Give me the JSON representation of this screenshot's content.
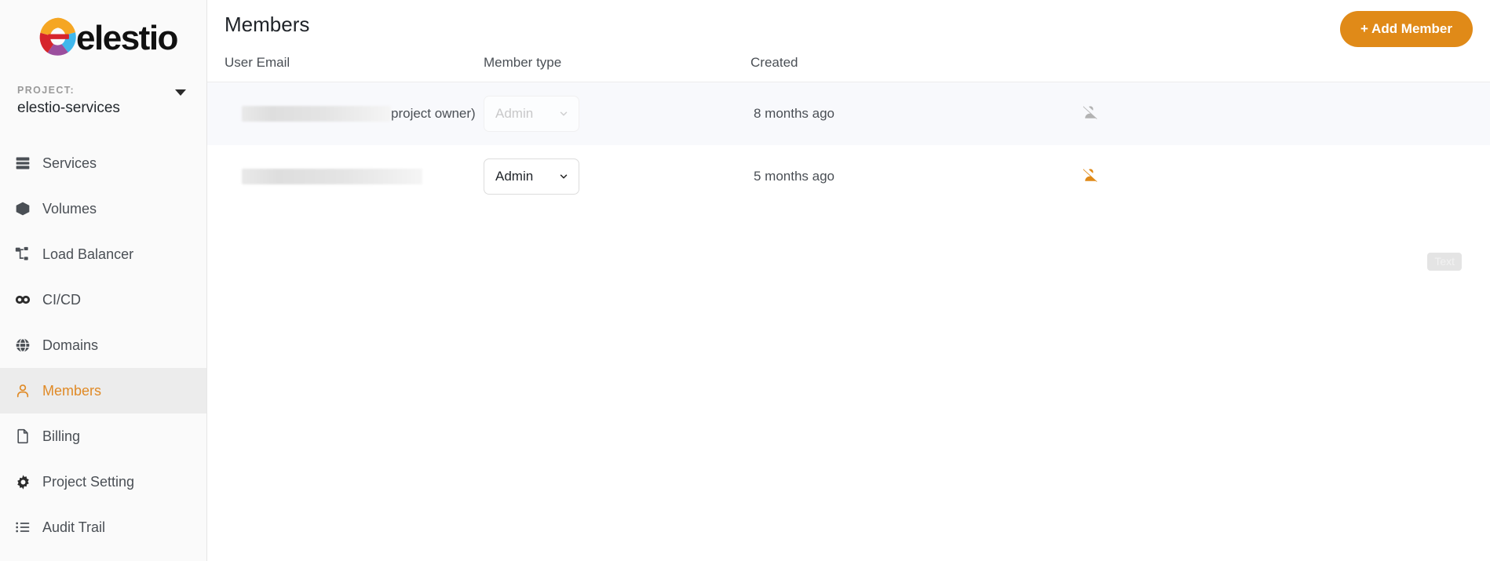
{
  "brand": {
    "name": "elestio",
    "logo_icon": "elestio-logo-icon",
    "accent_color": "#e08a18"
  },
  "sidebar": {
    "project_label": "PROJECT:",
    "project_name": "elestio-services",
    "project_caret_icon": "chevron-down-icon",
    "items": [
      {
        "label": "Services",
        "icon": "server-stack-icon",
        "active": false
      },
      {
        "label": "Volumes",
        "icon": "cube-icon",
        "active": false
      },
      {
        "label": "Load Balancer",
        "icon": "network-nodes-icon",
        "active": false
      },
      {
        "label": "CI/CD",
        "icon": "infinity-icon",
        "active": false
      },
      {
        "label": "Domains",
        "icon": "globe-icon",
        "active": false
      },
      {
        "label": "Members",
        "icon": "user-icon",
        "active": true
      },
      {
        "label": "Billing",
        "icon": "document-icon",
        "active": false
      },
      {
        "label": "Project Setting",
        "icon": "gear-icon",
        "active": false
      },
      {
        "label": "Audit Trail",
        "icon": "list-icon",
        "active": false
      }
    ]
  },
  "header": {
    "title": "Members",
    "add_member_label": "+ Add Member"
  },
  "table": {
    "columns": [
      "User Email",
      "Member type",
      "Created",
      ""
    ],
    "rows": [
      {
        "email_redacted": true,
        "email_suffix": "project owner)",
        "role": "Admin",
        "role_disabled": true,
        "created": "8 months ago",
        "remove_icon": "user-remove-icon",
        "remove_disabled": true,
        "shaded": true
      },
      {
        "email_redacted": true,
        "email_suffix": "",
        "role": "Admin",
        "role_disabled": false,
        "created": "5 months ago",
        "remove_icon": "user-remove-icon",
        "remove_disabled": false,
        "shaded": false
      }
    ]
  },
  "overlay": {
    "text_badge": "Text"
  }
}
